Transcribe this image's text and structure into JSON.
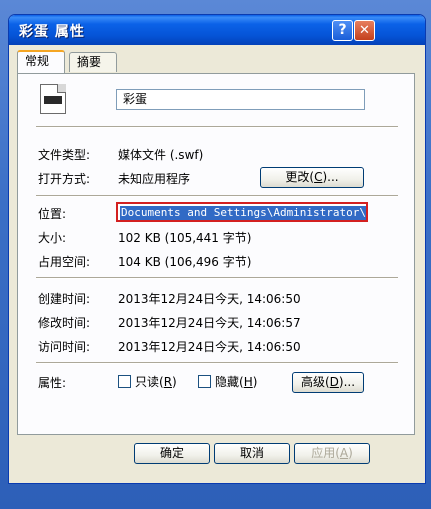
{
  "window": {
    "title": "彩蛋 属性",
    "help_glyph": "?",
    "close_glyph": "✕"
  },
  "tabs": [
    {
      "label": "常规",
      "active": true
    },
    {
      "label": "摘要",
      "active": false
    }
  ],
  "file": {
    "icon": "swf-file-icon",
    "name": "彩蛋"
  },
  "props": {
    "type_label": "文件类型:",
    "type_value": "媒体文件 (.swf)",
    "open_label": "打开方式:",
    "open_value": "未知应用程序",
    "change_btn_pre": "更改(",
    "change_btn_key": "C",
    "change_btn_post": ")...",
    "location_label": "位置:",
    "location_value": "Documents and Settings\\Administrator\\桌面",
    "size_label": "大小:",
    "size_value": "102 KB (105,441 字节)",
    "disk_label": "占用空间:",
    "disk_value": "104 KB (106,496 字节)",
    "created_label": "创建时间:",
    "created_value": "2013年12月24日今天, 14:06:50",
    "modified_label": "修改时间:",
    "modified_value": "2013年12月24日今天, 14:06:57",
    "accessed_label": "访问时间:",
    "accessed_value": "2013年12月24日今天, 14:06:50",
    "attr_label": "属性:",
    "readonly_pre": "只读(",
    "readonly_key": "R",
    "readonly_post": ")",
    "hidden_pre": "隐藏(",
    "hidden_key": "H",
    "hidden_post": ")",
    "advanced_pre": "高级(",
    "advanced_key": "D",
    "advanced_post": ")..."
  },
  "buttons": {
    "ok": "确定",
    "cancel": "取消",
    "apply_pre": "应用(",
    "apply_key": "A",
    "apply_post": ")"
  },
  "colors": {
    "titlebar": "#0553d6",
    "highlight": "#316ac5",
    "annotation_box": "#d32020"
  }
}
